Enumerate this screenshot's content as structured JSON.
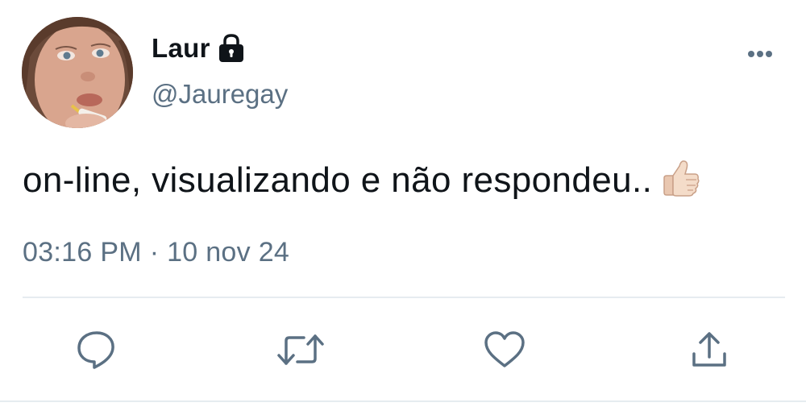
{
  "tweet": {
    "display_name": "Laur",
    "handle": "@Jauregay",
    "text": "on-line, visualizando e não respondeu..",
    "emoji_icon": "thumbs-up-icon",
    "time": "03:16 PM",
    "separator": "·",
    "date": "10 nov 24",
    "protected_icon": "lock-icon"
  },
  "actions": [
    {
      "name": "reply",
      "icon": "speech-bubble-icon"
    },
    {
      "name": "retweet",
      "icon": "retweet-arrows-icon"
    },
    {
      "name": "like",
      "icon": "heart-icon"
    },
    {
      "name": "share",
      "icon": "share-upload-icon"
    }
  ],
  "colors": {
    "text_primary": "#0f1419",
    "text_secondary": "#5b7083",
    "divider": "#e6ecf0",
    "background": "#ffffff"
  }
}
